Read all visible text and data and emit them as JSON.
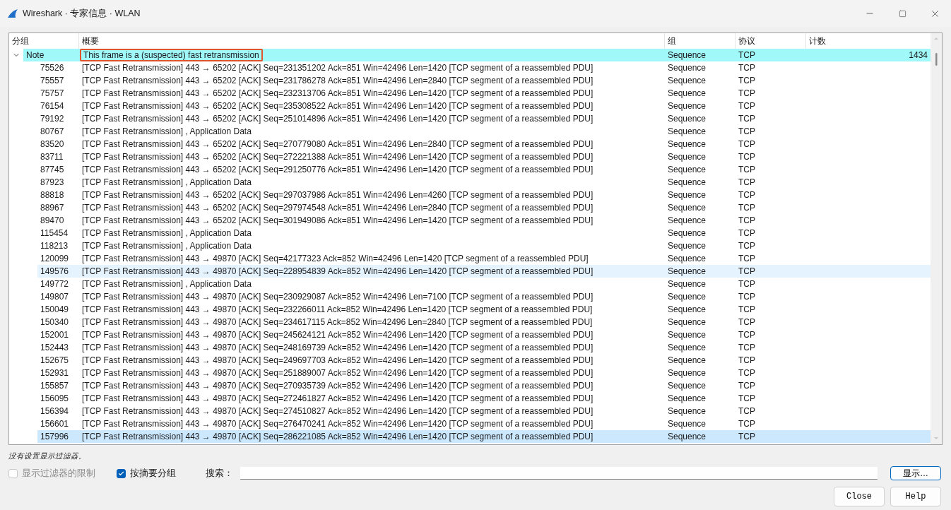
{
  "window": {
    "title": "Wireshark · 专家信息 · WLAN"
  },
  "table": {
    "columns": [
      "分组",
      "概要",
      "组",
      "协议",
      "计数"
    ],
    "groups": [
      {
        "severity": "Note",
        "summary": "This frame is a (suspected) fast retransmission",
        "group": "Sequence",
        "protocol": "TCP",
        "count": "1434",
        "expanded": true,
        "outlined": true,
        "children": [
          {
            "packet": "75526",
            "summary": "[TCP Fast Retransmission] 443 → 65202 [ACK] Seq=231351202 Ack=851 Win=42496 Len=1420 [TCP segment of a reassembled PDU]",
            "group": "Sequence",
            "protocol": "TCP",
            "selected": false,
            "hovered": false
          },
          {
            "packet": "75557",
            "summary": "[TCP Fast Retransmission] 443 → 65202 [ACK] Seq=231786278 Ack=851 Win=42496 Len=2840 [TCP segment of a reassembled PDU]",
            "group": "Sequence",
            "protocol": "TCP",
            "selected": false,
            "hovered": false
          },
          {
            "packet": "75757",
            "summary": "[TCP Fast Retransmission] 443 → 65202 [ACK] Seq=232313706 Ack=851 Win=42496 Len=1420 [TCP segment of a reassembled PDU]",
            "group": "Sequence",
            "protocol": "TCP",
            "selected": false,
            "hovered": false
          },
          {
            "packet": "76154",
            "summary": "[TCP Fast Retransmission] 443 → 65202 [ACK] Seq=235308522 Ack=851 Win=42496 Len=1420 [TCP segment of a reassembled PDU]",
            "group": "Sequence",
            "protocol": "TCP",
            "selected": false,
            "hovered": false
          },
          {
            "packet": "79192",
            "summary": "[TCP Fast Retransmission] 443 → 65202 [ACK] Seq=251014896 Ack=851 Win=42496 Len=1420 [TCP segment of a reassembled PDU]",
            "group": "Sequence",
            "protocol": "TCP",
            "selected": false,
            "hovered": false
          },
          {
            "packet": "80767",
            "summary": "[TCP Fast Retransmission] , Application Data",
            "group": "Sequence",
            "protocol": "TCP",
            "selected": false,
            "hovered": false
          },
          {
            "packet": "83520",
            "summary": "[TCP Fast Retransmission] 443 → 65202 [ACK] Seq=270779080 Ack=851 Win=42496 Len=2840 [TCP segment of a reassembled PDU]",
            "group": "Sequence",
            "protocol": "TCP",
            "selected": false,
            "hovered": false
          },
          {
            "packet": "83711",
            "summary": "[TCP Fast Retransmission] 443 → 65202 [ACK] Seq=272221388 Ack=851 Win=42496 Len=1420 [TCP segment of a reassembled PDU]",
            "group": "Sequence",
            "protocol": "TCP",
            "selected": false,
            "hovered": false
          },
          {
            "packet": "87745",
            "summary": "[TCP Fast Retransmission] 443 → 65202 [ACK] Seq=291250776 Ack=851 Win=42496 Len=1420 [TCP segment of a reassembled PDU]",
            "group": "Sequence",
            "protocol": "TCP",
            "selected": false,
            "hovered": false
          },
          {
            "packet": "87923",
            "summary": "[TCP Fast Retransmission] , Application Data",
            "group": "Sequence",
            "protocol": "TCP",
            "selected": false,
            "hovered": false
          },
          {
            "packet": "88818",
            "summary": "[TCP Fast Retransmission] 443 → 65202 [ACK] Seq=297037986 Ack=851 Win=42496 Len=4260 [TCP segment of a reassembled PDU]",
            "group": "Sequence",
            "protocol": "TCP",
            "selected": false,
            "hovered": false
          },
          {
            "packet": "88967",
            "summary": "[TCP Fast Retransmission] 443 → 65202 [ACK] Seq=297974548 Ack=851 Win=42496 Len=2840 [TCP segment of a reassembled PDU]",
            "group": "Sequence",
            "protocol": "TCP",
            "selected": false,
            "hovered": false
          },
          {
            "packet": "89470",
            "summary": "[TCP Fast Retransmission] 443 → 65202 [ACK] Seq=301949086 Ack=851 Win=42496 Len=1420 [TCP segment of a reassembled PDU]",
            "group": "Sequence",
            "protocol": "TCP",
            "selected": false,
            "hovered": false
          },
          {
            "packet": "115454",
            "summary": "[TCP Fast Retransmission] , Application Data",
            "group": "Sequence",
            "protocol": "TCP",
            "selected": false,
            "hovered": false
          },
          {
            "packet": "118213",
            "summary": "[TCP Fast Retransmission] , Application Data",
            "group": "Sequence",
            "protocol": "TCP",
            "selected": false,
            "hovered": false
          },
          {
            "packet": "120099",
            "summary": "[TCP Fast Retransmission] 443 → 49870 [ACK] Seq=42177323 Ack=852 Win=42496 Len=1420 [TCP segment of a reassembled PDU]",
            "group": "Sequence",
            "protocol": "TCP",
            "selected": false,
            "hovered": false
          },
          {
            "packet": "149576",
            "summary": "[TCP Fast Retransmission] 443 → 49870 [ACK] Seq=228954839 Ack=852 Win=42496 Len=1420 [TCP segment of a reassembled PDU]",
            "group": "Sequence",
            "protocol": "TCP",
            "selected": false,
            "hovered": true
          },
          {
            "packet": "149772",
            "summary": "[TCP Fast Retransmission] , Application Data",
            "group": "Sequence",
            "protocol": "TCP",
            "selected": false,
            "hovered": false
          },
          {
            "packet": "149807",
            "summary": "[TCP Fast Retransmission] 443 → 49870 [ACK] Seq=230929087 Ack=852 Win=42496 Len=7100 [TCP segment of a reassembled PDU]",
            "group": "Sequence",
            "protocol": "TCP",
            "selected": false,
            "hovered": false
          },
          {
            "packet": "150049",
            "summary": "[TCP Fast Retransmission] 443 → 49870 [ACK] Seq=232266011 Ack=852 Win=42496 Len=1420 [TCP segment of a reassembled PDU]",
            "group": "Sequence",
            "protocol": "TCP",
            "selected": false,
            "hovered": false
          },
          {
            "packet": "150340",
            "summary": "[TCP Fast Retransmission] 443 → 49870 [ACK] Seq=234617115 Ack=852 Win=42496 Len=2840 [TCP segment of a reassembled PDU]",
            "group": "Sequence",
            "protocol": "TCP",
            "selected": false,
            "hovered": false
          },
          {
            "packet": "152001",
            "summary": "[TCP Fast Retransmission] 443 → 49870 [ACK] Seq=245624121 Ack=852 Win=42496 Len=1420 [TCP segment of a reassembled PDU]",
            "group": "Sequence",
            "protocol": "TCP",
            "selected": false,
            "hovered": false
          },
          {
            "packet": "152443",
            "summary": "[TCP Fast Retransmission] 443 → 49870 [ACK] Seq=248169739 Ack=852 Win=42496 Len=1420 [TCP segment of a reassembled PDU]",
            "group": "Sequence",
            "protocol": "TCP",
            "selected": false,
            "hovered": false
          },
          {
            "packet": "152675",
            "summary": "[TCP Fast Retransmission] 443 → 49870 [ACK] Seq=249697703 Ack=852 Win=42496 Len=1420 [TCP segment of a reassembled PDU]",
            "group": "Sequence",
            "protocol": "TCP",
            "selected": false,
            "hovered": false
          },
          {
            "packet": "152931",
            "summary": "[TCP Fast Retransmission] 443 → 49870 [ACK] Seq=251889007 Ack=852 Win=42496 Len=1420 [TCP segment of a reassembled PDU]",
            "group": "Sequence",
            "protocol": "TCP",
            "selected": false,
            "hovered": false
          },
          {
            "packet": "155857",
            "summary": "[TCP Fast Retransmission] 443 → 49870 [ACK] Seq=270935739 Ack=852 Win=42496 Len=1420 [TCP segment of a reassembled PDU]",
            "group": "Sequence",
            "protocol": "TCP",
            "selected": false,
            "hovered": false
          },
          {
            "packet": "156095",
            "summary": "[TCP Fast Retransmission] 443 → 49870 [ACK] Seq=272461827 Ack=852 Win=42496 Len=1420 [TCP segment of a reassembled PDU]",
            "group": "Sequence",
            "protocol": "TCP",
            "selected": false,
            "hovered": false
          },
          {
            "packet": "156394",
            "summary": "[TCP Fast Retransmission] 443 → 49870 [ACK] Seq=274510827 Ack=852 Win=42496 Len=1420 [TCP segment of a reassembled PDU]",
            "group": "Sequence",
            "protocol": "TCP",
            "selected": false,
            "hovered": false
          },
          {
            "packet": "156601",
            "summary": "[TCP Fast Retransmission] 443 → 49870 [ACK] Seq=276470241 Ack=852 Win=42496 Len=1420 [TCP segment of a reassembled PDU]",
            "group": "Sequence",
            "protocol": "TCP",
            "selected": false,
            "hovered": false
          },
          {
            "packet": "157996",
            "summary": "[TCP Fast Retransmission] 443 → 49870 [ACK] Seq=286221085 Ack=852 Win=42496 Len=1420 [TCP segment of a reassembled PDU]",
            "group": "Sequence",
            "protocol": "TCP",
            "selected": true,
            "hovered": false
          }
        ]
      }
    ]
  },
  "status": "没有设置显示过滤器。",
  "options": [
    {
      "label": "显示过滤器的限制",
      "checked": false,
      "disabled": true
    },
    {
      "label": "按摘要分组",
      "checked": true,
      "disabled": false
    }
  ],
  "search": {
    "label": "搜索："
  },
  "buttons": [
    {
      "label": "显示…",
      "default": true
    },
    {
      "label": "Close",
      "default": false
    },
    {
      "label": "Help",
      "default": false
    }
  ]
}
